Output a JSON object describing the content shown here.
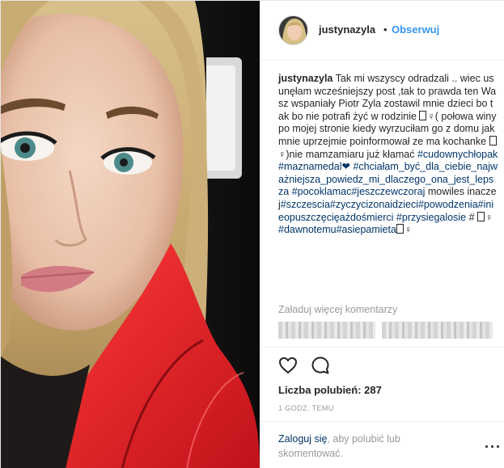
{
  "header": {
    "username": "justynazyla",
    "separator": "•",
    "follow_label": "Obserwuj"
  },
  "caption": {
    "username": "justynazyla",
    "text1": "Tak mi wszyscy odradzali .. wiec usunęłam wcześniejszy post ,tak to prawda ten Wasz wspaniały Piotr Zyla zostawil mnie dzieci bo tak bo nie potrafi żyć w rodzinie",
    "text2": "( połowa winy po mojej stronie kiedy wyrzuciłam go z domu jak mnie uprzejmie poinformował ze ma kochanke",
    "text3": ")nie mamzamiaru już kłamać",
    "tag_cudowny": "#cudownychłopak",
    "tag_maznamedal": "#maznamedal❤",
    "tag_chcialam": "#chciałam_być_dla_ciebie_najważniejsza_powiedz_mi_dlaczego_ona_jest_lepsza",
    "tag_pocoklamac": "#pocoklamac#jeszczewczoraj",
    "text4": "mowiles inaczej",
    "tag_szczescia": "#szczescia#zyczycizonaidzieci#powodzenia#inieopuszczęcięażdośmierci",
    "tag_przysiegalosie": "#przysiegalosie",
    "text5": "#",
    "tag_dawnotemu": "#dawnotemu#asiepamieta",
    "symbol_female": "♀"
  },
  "load_more": "Załaduj więcej komentarzy",
  "actions": {
    "like_icon": "heart-outline-icon",
    "comment_icon": "speech-bubble-icon"
  },
  "likes": "Liczba polubień: 287",
  "time": "1 GODZ. TEMU",
  "login": {
    "link_label": "Zaloguj się",
    "rest_text": ", aby polubić lub skomentować."
  },
  "colors": {
    "link": "#003569",
    "follow": "#3897f0",
    "muted": "#999999",
    "text": "#262626"
  }
}
